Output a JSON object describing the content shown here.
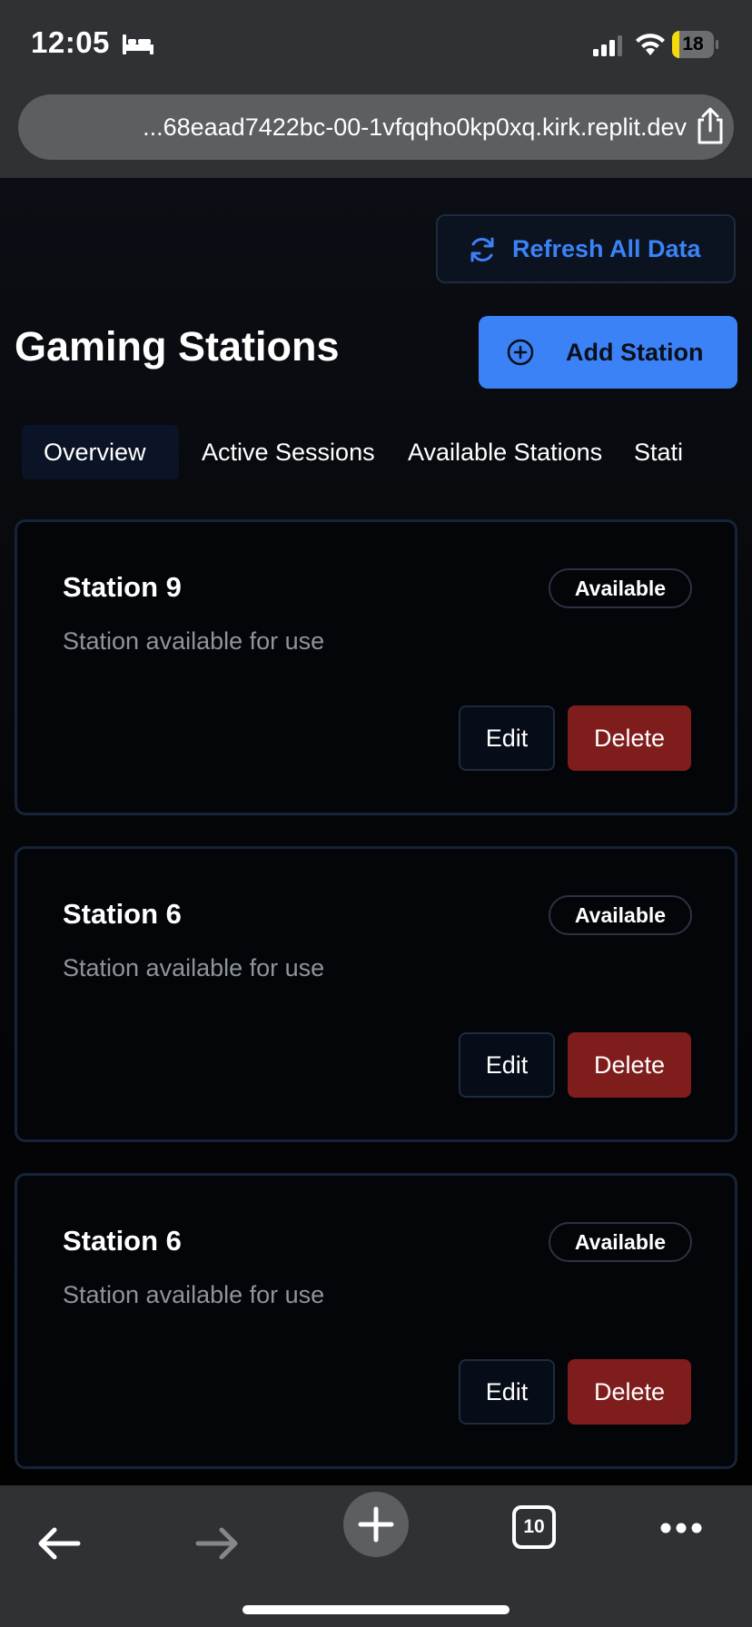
{
  "status_bar": {
    "time": "12:05",
    "battery_level": "18",
    "battery_fraction": 0.18,
    "icons": [
      "bed-icon",
      "signal-icon",
      "wifi-icon",
      "battery-icon"
    ]
  },
  "browser": {
    "url": "...68eaad7422bc-00-1vfqqho0kp0xq.kirk.replit.dev",
    "share_icon": "share-icon",
    "tab_count": "10",
    "toolbar_icons": [
      "back-arrow-icon",
      "forward-arrow-icon",
      "new-tab-plus-icon",
      "tabs-icon",
      "more-icon"
    ]
  },
  "header": {
    "refresh_label": "Refresh All Data",
    "title": "Gaming Stations",
    "add_label": "Add Station"
  },
  "tabs": [
    {
      "label": "Overview",
      "active": true
    },
    {
      "label": "Active Sessions",
      "active": false
    },
    {
      "label": "Available Stations",
      "active": false
    },
    {
      "label": "Stati",
      "active": false
    }
  ],
  "stations": [
    {
      "name": "Station 9",
      "description": "Station available for use",
      "status": "Available",
      "edit_label": "Edit",
      "delete_label": "Delete"
    },
    {
      "name": "Station 6",
      "description": "Station available for use",
      "status": "Available",
      "edit_label": "Edit",
      "delete_label": "Delete"
    },
    {
      "name": "Station 6",
      "description": "Station available for use",
      "status": "Available",
      "edit_label": "Edit",
      "delete_label": "Delete"
    }
  ],
  "colors": {
    "accent": "#3b82f6",
    "danger": "#7f1d1d",
    "chrome": "#2f3134",
    "battery": "#f5d90a"
  }
}
